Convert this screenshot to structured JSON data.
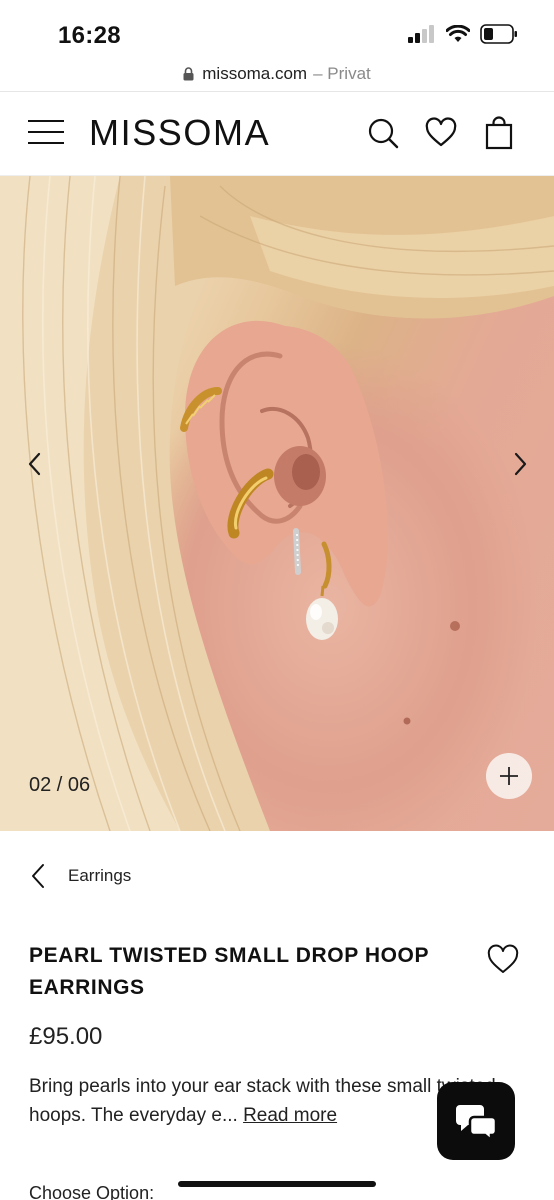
{
  "status_bar": {
    "time": "16:28"
  },
  "browser": {
    "domain": "missoma.com",
    "mode": "– Privat"
  },
  "header": {
    "logo": "MISSOMA",
    "icons": [
      "menu-icon",
      "search-icon",
      "heart-icon",
      "shopping-bag-icon"
    ]
  },
  "gallery": {
    "counter": "02 / 06",
    "current_slide": 2,
    "total_slides": 6
  },
  "breadcrumb": {
    "label": "Earrings"
  },
  "product": {
    "title": "PEARL TWISTED SMALL DROP HOOP EARRINGS",
    "price": "£95.00",
    "description_text": "Bring pearls into your ear stack with these small twisted hoops. The everyday e...",
    "read_more": "Read more"
  },
  "options": {
    "label": "Choose Option:"
  },
  "colors": {
    "accent": "#111111",
    "chat_bg": "#0c0c0c",
    "skin": "#e5ab9a",
    "hair": "#e8cfa6",
    "gold": "#d7a53a"
  }
}
